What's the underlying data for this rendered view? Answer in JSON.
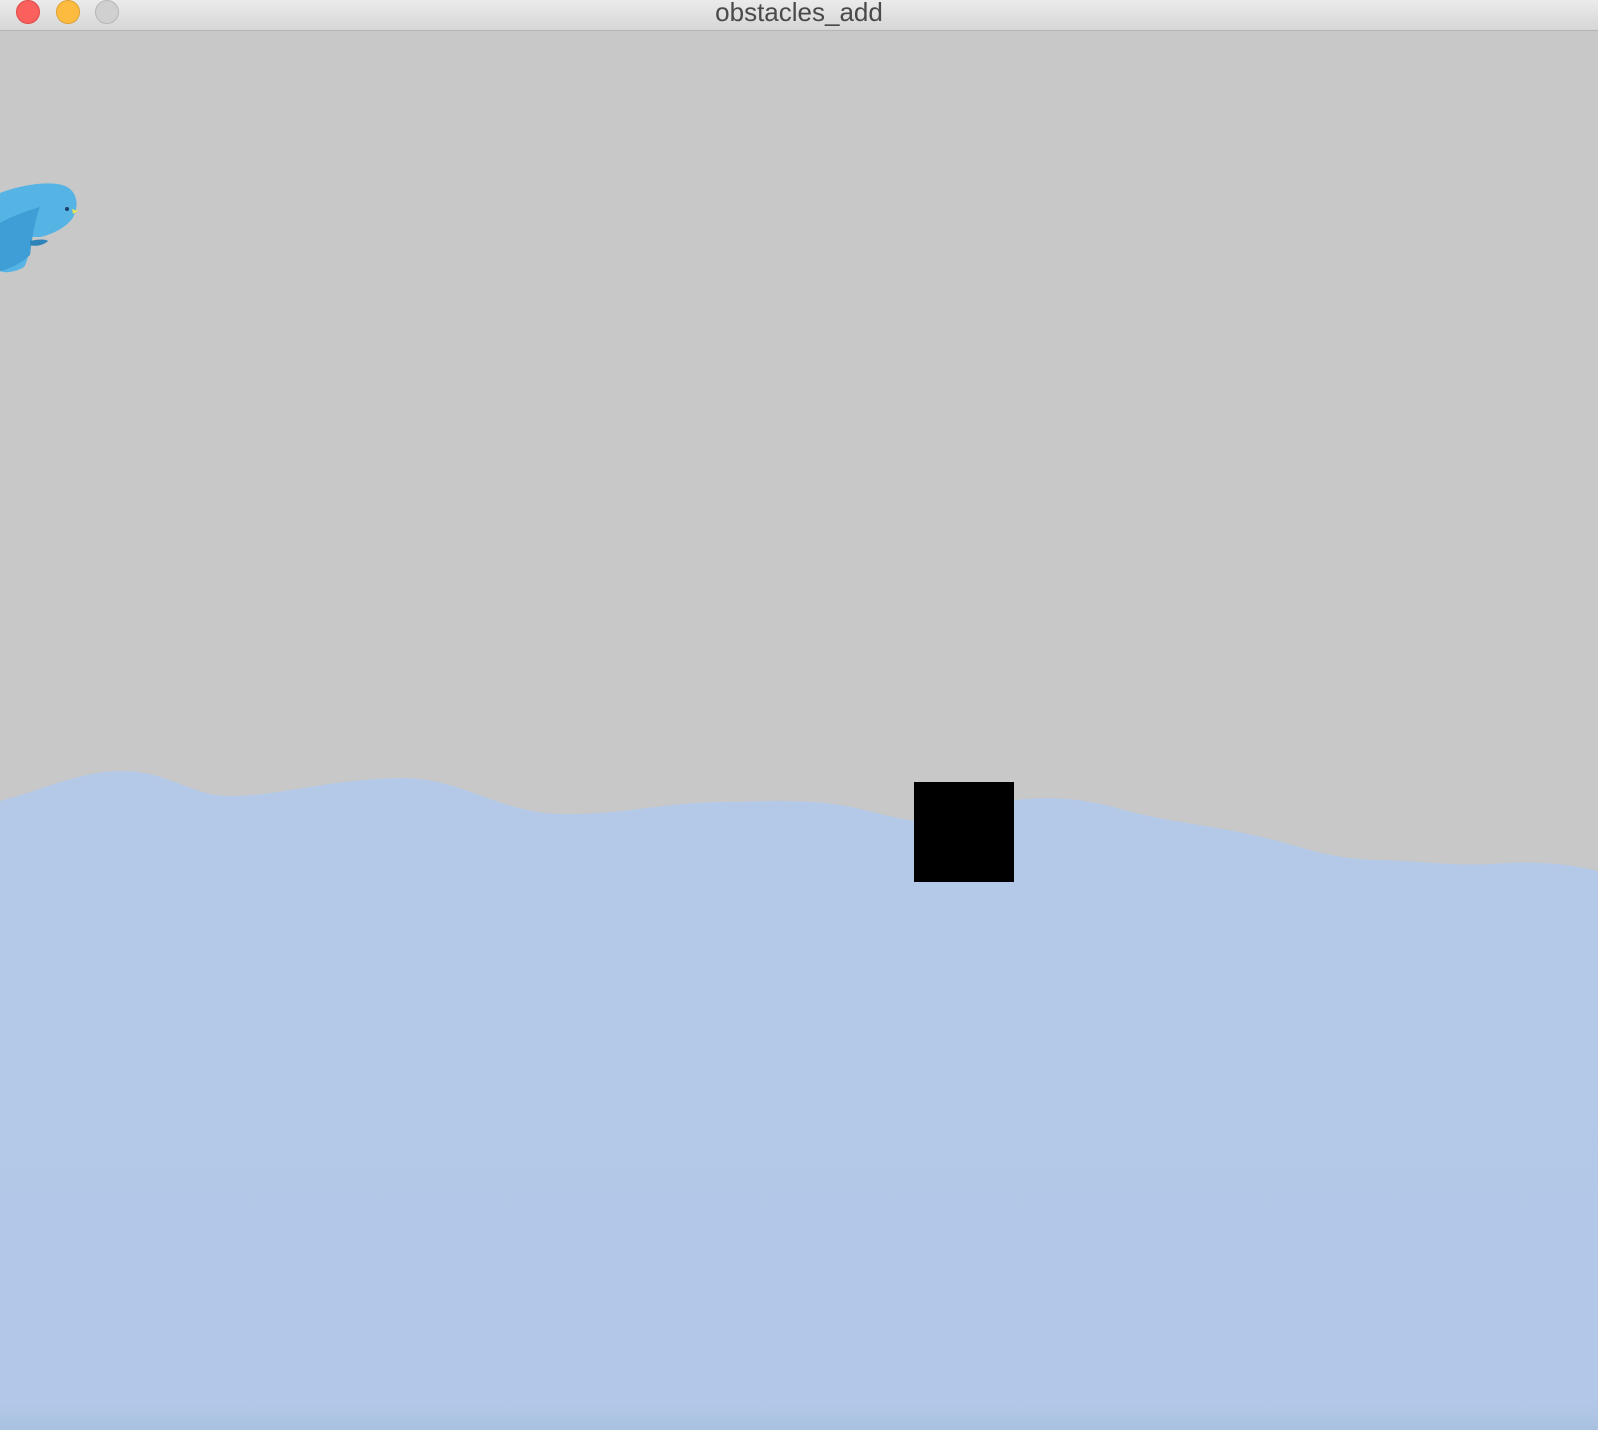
{
  "window": {
    "title": "obstacles_add"
  },
  "colors": {
    "sky": "#c8c8c8",
    "water": "#b4c9e8",
    "water_bottom": "#a9c1e0",
    "obstacle": "#000000",
    "bird_body": "#55b4e4",
    "bird_wing": "#3f9ed6",
    "bird_beak": "#e4e455"
  },
  "scene": {
    "player": "bird",
    "obstacles": [
      {
        "shape": "square"
      }
    ]
  }
}
